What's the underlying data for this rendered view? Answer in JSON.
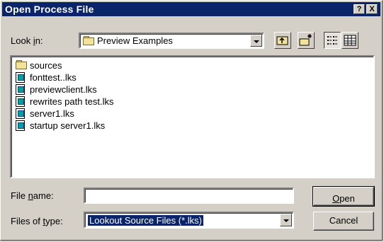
{
  "dialog": {
    "title": "Open Process File",
    "help_button": "?",
    "close_button": "X"
  },
  "lookin": {
    "label_pre": "Look ",
    "label_ul": "i",
    "label_post": "n:",
    "value": "Preview Examples"
  },
  "toolbar": {
    "up_icon": "up-one-level-icon",
    "new_folder_icon": "new-folder-icon",
    "list_icon": "list-view-icon",
    "details_icon": "details-view-icon"
  },
  "files": [
    {
      "name": "sources",
      "icon": "folder-icon"
    },
    {
      "name": "fonttest..lks",
      "icon": "process-file-icon"
    },
    {
      "name": "previewclient.lks",
      "icon": "process-file-icon"
    },
    {
      "name": "rewrites path test.lks",
      "icon": "process-file-icon"
    },
    {
      "name": "server1.lks",
      "icon": "process-file-icon"
    },
    {
      "name": "startup server1.lks",
      "icon": "process-file-icon"
    }
  ],
  "filename": {
    "label_pre": "File ",
    "label_ul": "n",
    "label_post": "ame:",
    "value": ""
  },
  "filetype": {
    "label_pre": "Files of ",
    "label_ul": "t",
    "label_post": "ype:",
    "value": "Lookout Source Files  (*.lks)"
  },
  "buttons": {
    "open_ul": "O",
    "open_rest": "pen",
    "cancel": "Cancel"
  }
}
